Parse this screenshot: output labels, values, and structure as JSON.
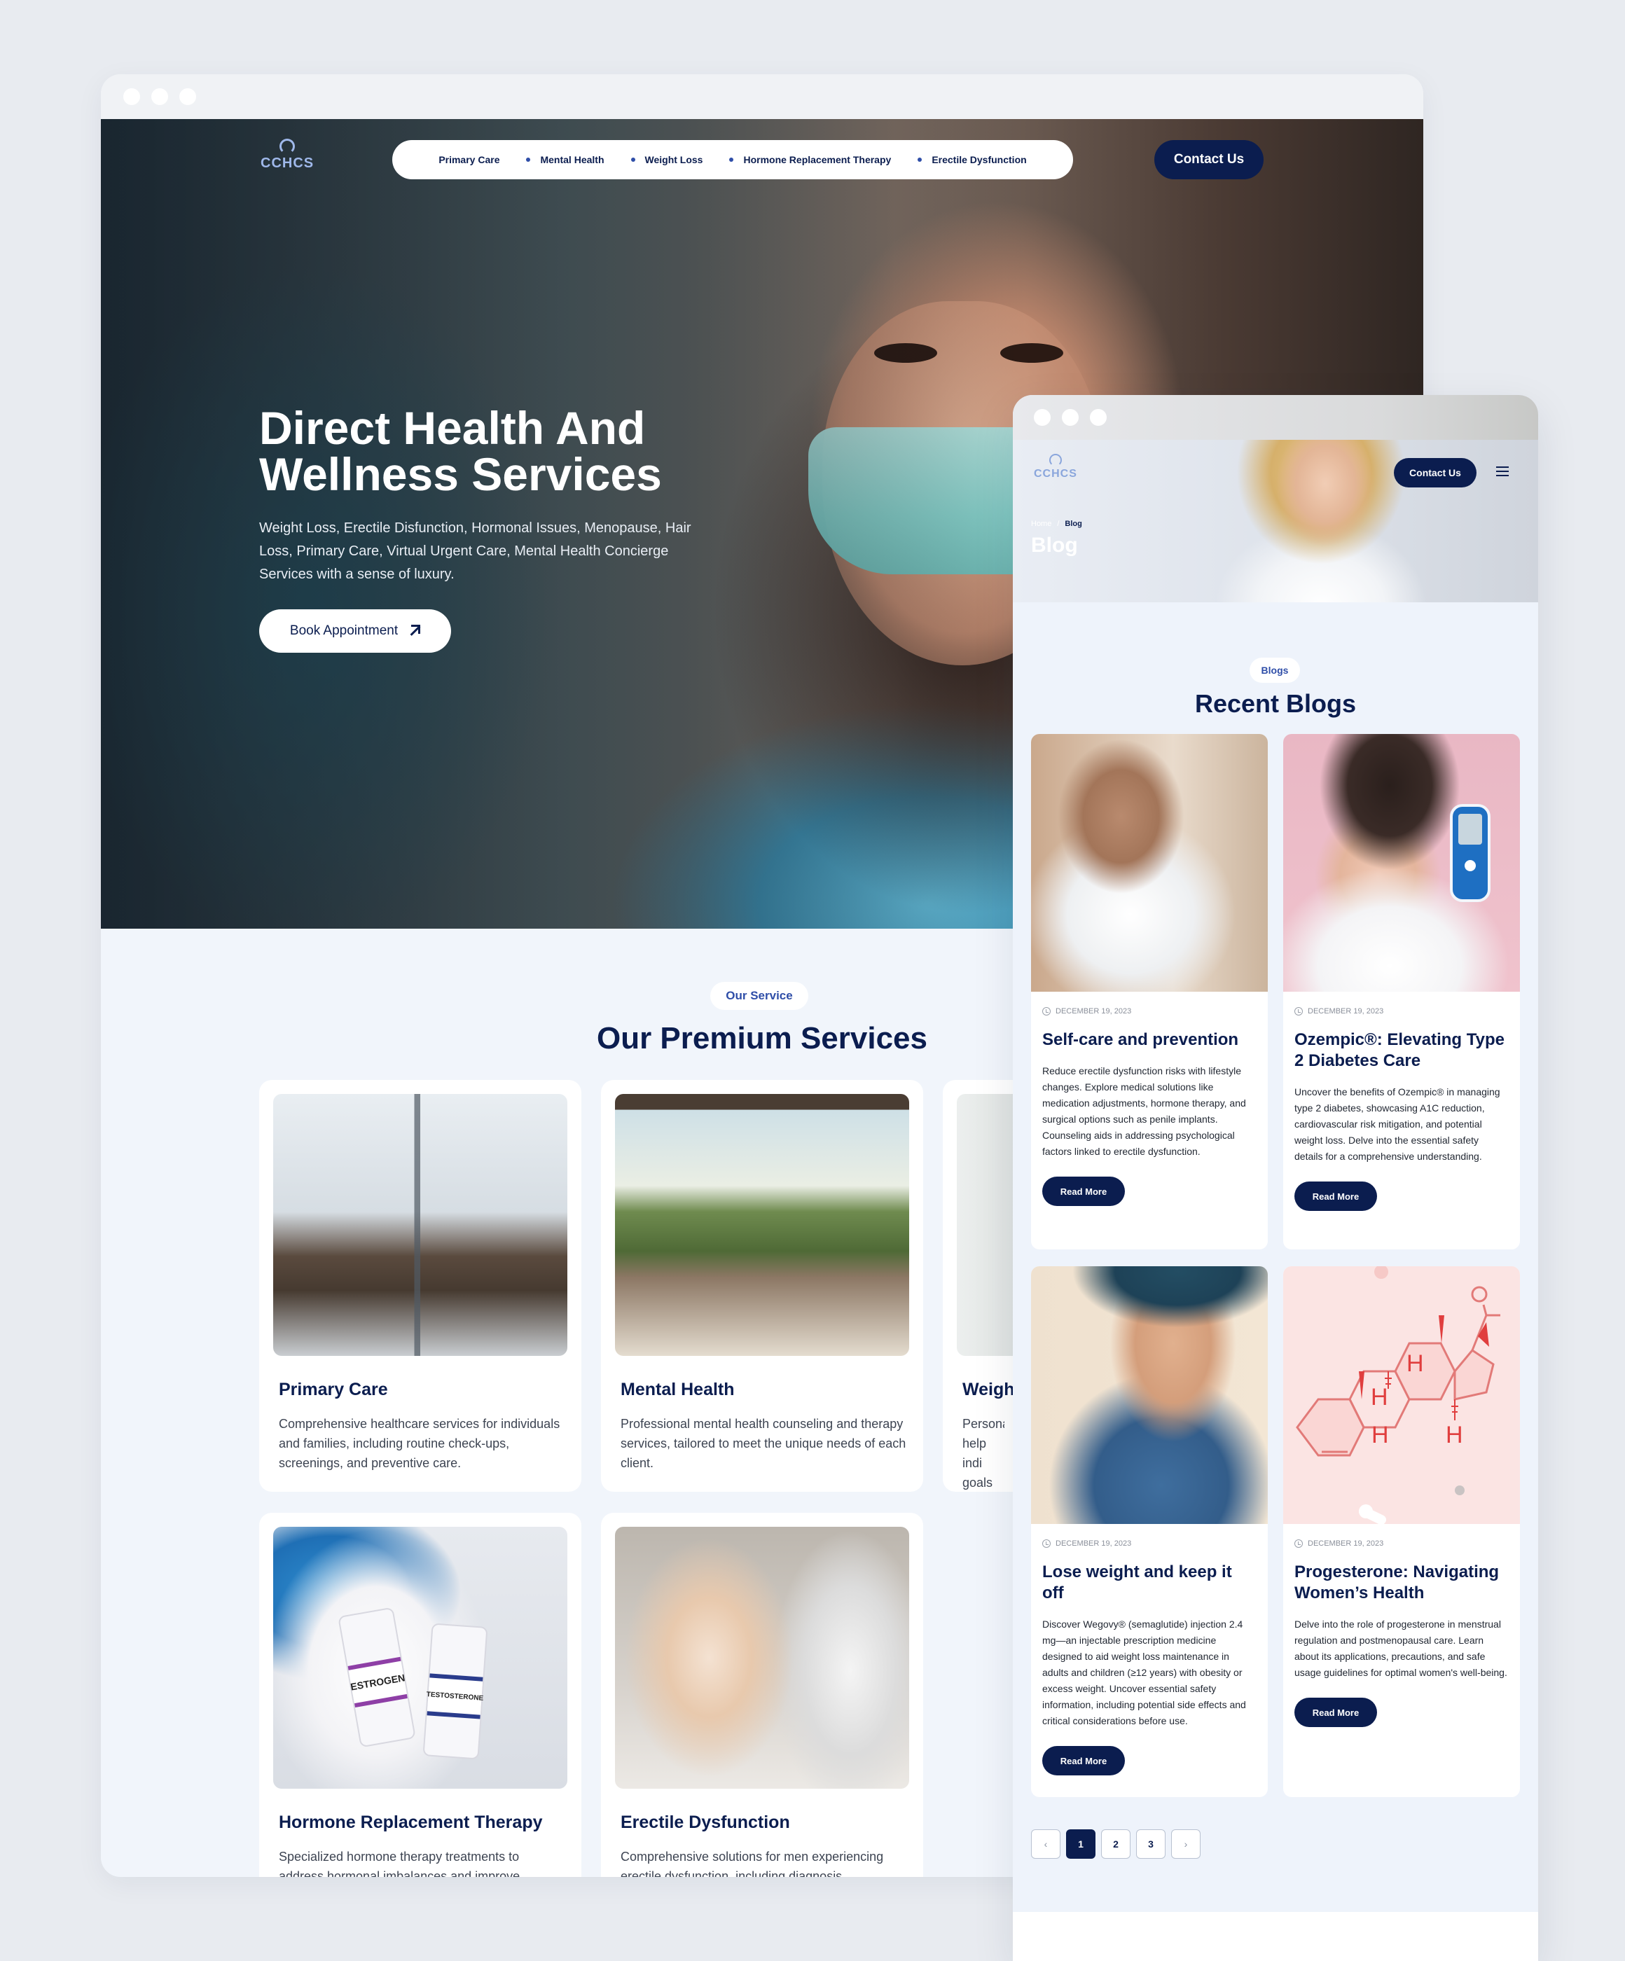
{
  "desktop": {
    "logo_text": "CCHCS",
    "nav": [
      "Primary Care",
      "Mental Health",
      "Weight Loss",
      "Hormone Replacement Therapy",
      "Erectile Dysfunction"
    ],
    "contact_label": "Contact Us",
    "hero": {
      "title_line1": "Direct Health And",
      "title_line2": "Wellness Services",
      "subtitle": "Weight Loss, Erectile Disfunction, Hormonal Issues, Menopause, Hair Loss, Primary Care, Virtual Urgent Care, Mental Health Concierge Services with a sense of luxury.",
      "book_label": "Book Appointment"
    },
    "services": {
      "tag": "Our Service",
      "title": "Our Premium Services",
      "items": [
        {
          "name": "Primary Care",
          "desc": "Comprehensive healthcare services for individuals and families, including routine check-ups, screenings, and preventive care."
        },
        {
          "name": "Mental Health",
          "desc": "Professional mental health counseling and therapy services, tailored to meet the unique needs of each client."
        },
        {
          "name": "Weigh",
          "desc": "Personal help indi goals sa"
        },
        {
          "name": "Hormone Replacement Therapy",
          "desc": "Specialized hormone therapy treatments to address hormonal imbalances and improve"
        },
        {
          "name": "Erectile Dysfunction",
          "desc": "Comprehensive solutions for men experiencing erectile dysfunction, including diagnosis,"
        }
      ],
      "vial_labels": [
        "ESTROGEN",
        "TESTOSTERONE"
      ]
    }
  },
  "blog": {
    "logo_text": "CCHCS",
    "contact_label": "Contact Us",
    "breadcrumb": {
      "home": "Home",
      "sep": "/",
      "current": "Blog"
    },
    "page_title": "Blog",
    "tag": "Blogs",
    "title": "Recent Blogs",
    "read_more": "Read More",
    "posts": [
      {
        "date": "DECEMBER 19, 2023",
        "title": "Self-care and prevention",
        "desc": "Reduce erectile dysfunction risks with lifestyle changes. Explore medical solutions like medication adjustments, hormone therapy, and surgical options such as penile implants. Counseling aids in addressing psychological factors linked to erectile dysfunction."
      },
      {
        "date": "DECEMBER 19, 2023",
        "title": "Ozempic®: Elevating Type 2 Diabetes Care",
        "desc": "Uncover the benefits of Ozempic® in managing type 2 diabetes, showcasing A1C reduction, cardiovascular risk mitigation, and potential weight loss. Delve into the essential safety details for a comprehensive understanding."
      },
      {
        "date": "DECEMBER 19, 2023",
        "title": "Lose weight and keep it off",
        "desc": "Discover Wegovy® (semaglutide) injection 2.4 mg—an injectable prescription medicine designed to aid weight loss maintenance in adults and children (≥12 years) with obesity or excess weight. Uncover essential safety information, including potential side effects and critical considerations before use."
      },
      {
        "date": "DECEMBER 19, 2023",
        "title": "Progesterone: Navigating Women’s Health",
        "desc": "Delve into the role of progesterone in menstrual regulation and postmenopausal care. Learn about its applications, precautions, and safe usage guidelines for optimal women's well-being."
      }
    ],
    "pagination": {
      "prev": "‹",
      "pages": [
        "1",
        "2",
        "3"
      ],
      "next": "›",
      "current": "1"
    }
  }
}
